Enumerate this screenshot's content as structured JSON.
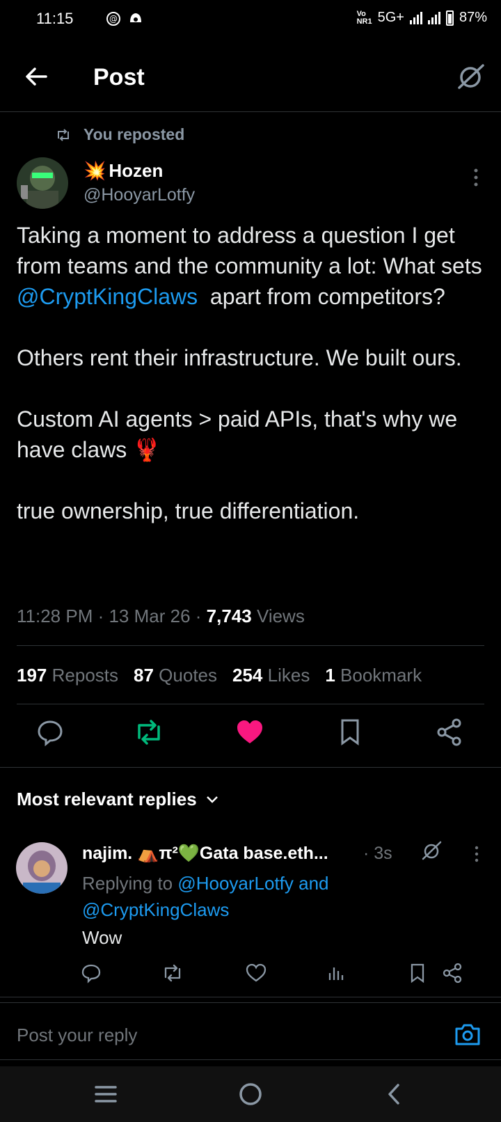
{
  "status_bar": {
    "time": "11:15",
    "network": "5G+",
    "battery": "87%"
  },
  "header": {
    "title": "Post"
  },
  "post": {
    "repost_label": "You reposted",
    "author_name": "Hozen",
    "author_emoji": "💥",
    "author_handle": "@HooyarLotfy",
    "body_part1": "Taking a moment to address a question I get from teams and the community a lot: What sets ",
    "body_mention": "@CryptKingClaws",
    "body_part2": "  apart from competitors?\n\nOthers rent their infrastructure. We built ours.\n\nCustom AI agents > paid APIs, that's why we have claws 🦞\n\ntrue ownership, true differentiation.",
    "timestamp": "11:28 PM · 13 Mar 26 · ",
    "views_count": "7,743",
    "views_label": " Views",
    "stats": {
      "reposts_count": "197",
      "reposts_label": "Reposts",
      "quotes_count": "87",
      "quotes_label": "Quotes",
      "likes_count": "254",
      "likes_label": "Likes",
      "bookmarks_count": "1",
      "bookmarks_label": "Bookmark"
    }
  },
  "replies_section": {
    "sort_label": "Most relevant replies"
  },
  "reply": {
    "name": "najim. ⛺π²💚Gata base.eth...",
    "time": "· 3s",
    "replying_prefix": "Replying to ",
    "replying_handles": "@HooyarLotfy and @CryptKingClaws",
    "body": "Wow"
  },
  "composer": {
    "placeholder": "Post your reply"
  },
  "colors": {
    "accent": "#1d9bf0",
    "repost_green": "#00ba7c",
    "like_pink": "#f91880",
    "muted": "#71767b"
  }
}
